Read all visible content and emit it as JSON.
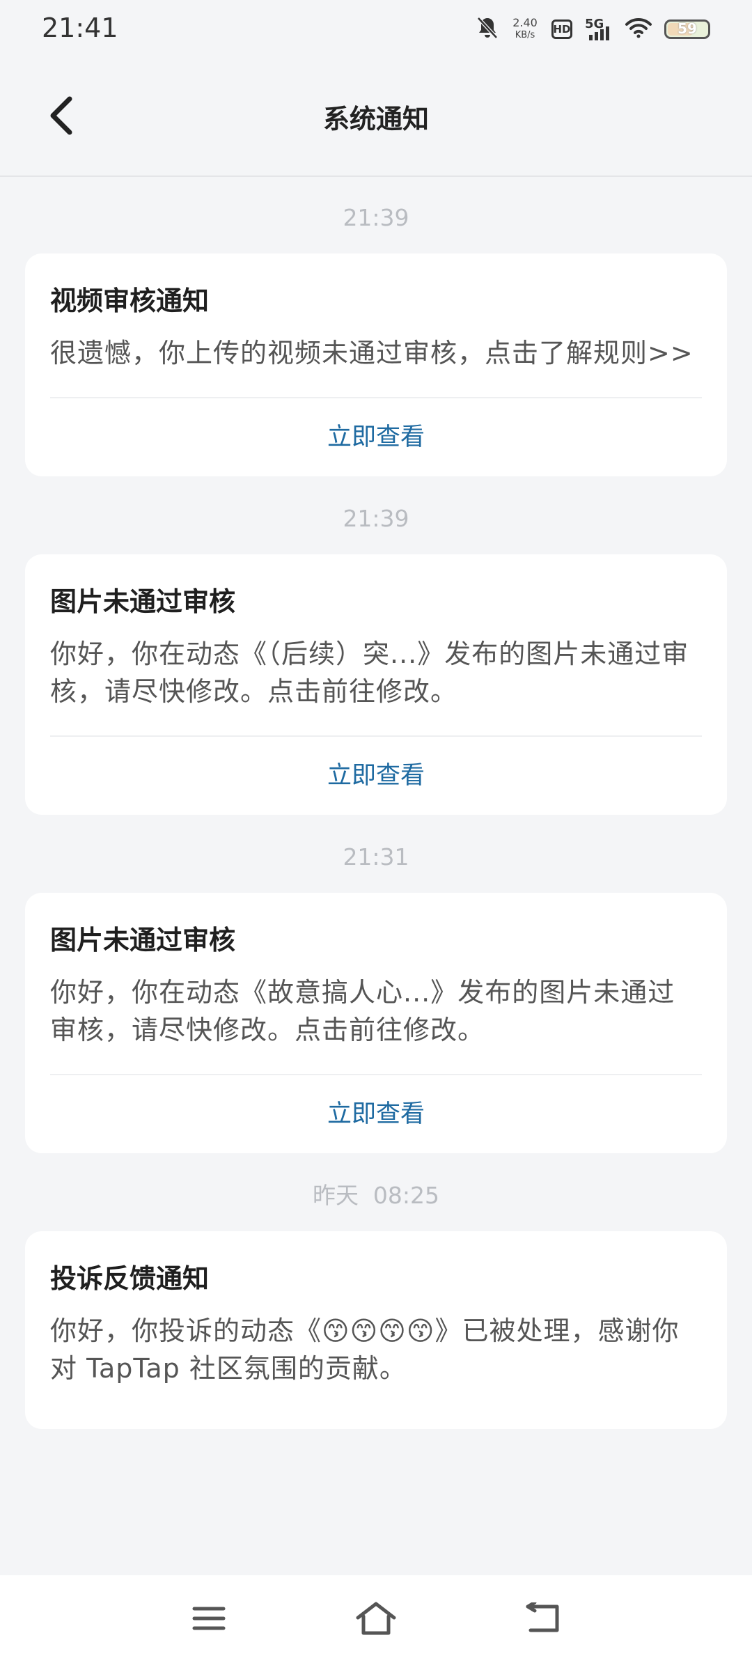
{
  "status_bar": {
    "time": "21:41",
    "net_speed_value": "2.40",
    "net_speed_unit": "KB/s",
    "hd_label": "HD",
    "network_label": "5G",
    "battery_level": "59"
  },
  "header": {
    "title": "系统通知"
  },
  "notifications": [
    {
      "time": "21:39",
      "title": "视频审核通知",
      "body": "很遗憾，你上传的视频未通过审核，点击了解规则>>",
      "action": "立即查看"
    },
    {
      "time": "21:39",
      "title": "图片未通过审核",
      "body": "你好，你在动态《（后续）突...》发布的图片未通过审核，请尽快修改。点击前往修改。",
      "action": "立即查看"
    },
    {
      "time": "21:31",
      "title": "图片未通过审核",
      "body": "你好，你在动态《故意搞人心...》发布的图片未通过审核，请尽快修改。点击前往修改。",
      "action": "立即查看"
    },
    {
      "time": "昨天  08:25",
      "title": "投诉反馈通知",
      "body": "你好，你投诉的动态《😙😙😙😙》已被处理，感谢你对 TapTap 社区氛围的贡献。"
    }
  ],
  "icons": {
    "back": "chevron-left-icon",
    "mute": "bell-off-icon",
    "wifi": "wifi-icon",
    "menu": "menu-icon",
    "home": "home-icon",
    "back_nav": "back-arrow-icon"
  },
  "colors": {
    "background": "#f4f5f7",
    "card": "#ffffff",
    "action_link": "#1e6aa1",
    "timestamp": "#b9bcc1"
  }
}
